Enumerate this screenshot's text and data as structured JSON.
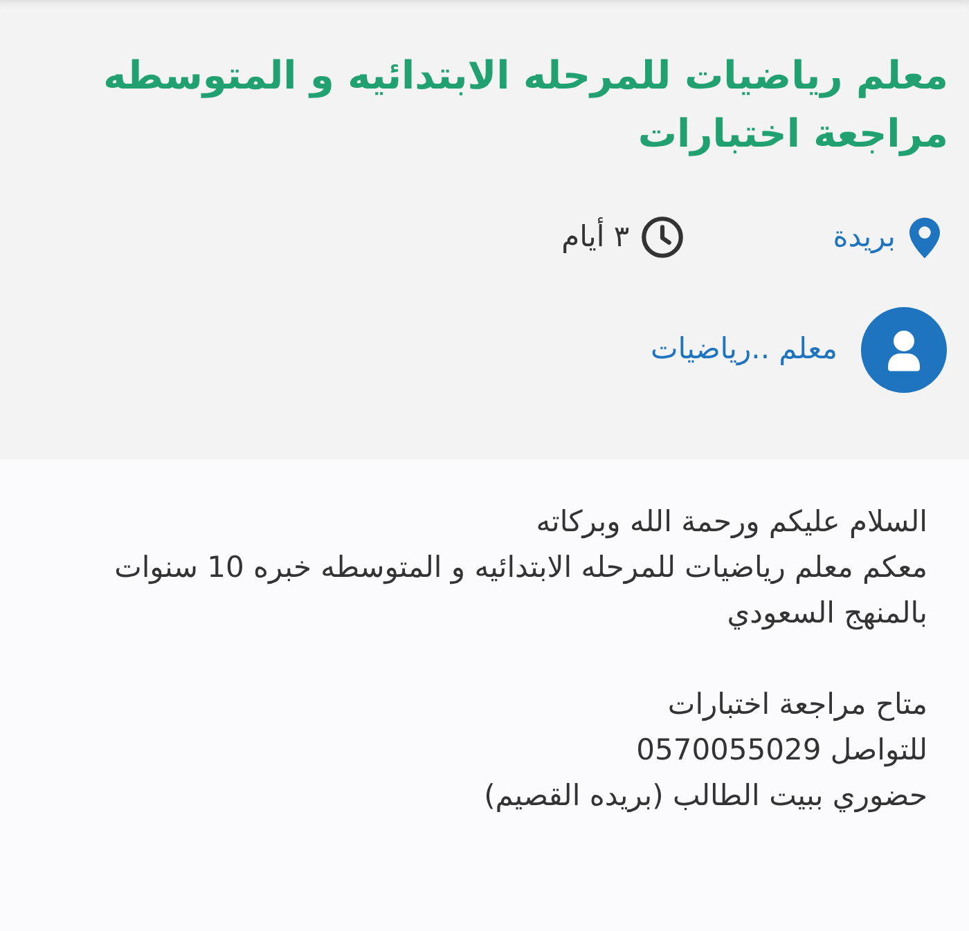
{
  "listing": {
    "title": "معلم رياضيات للمرحله الابتدائيه و المتوسطه مراجعة اختبارات",
    "location": "بريدة",
    "age": "٣ أيام",
    "author": "معلم ..رياضيات"
  },
  "description": {
    "paragraphs": [
      [
        "السلام عليكم ورحمة الله وبركاته",
        "معكم معلم رياضيات للمرحله الابتدائيه و المتوسطه خبره 10 سنوات بالمنهج السعودي"
      ],
      [
        "متاح مراجعة اختبارات",
        "للتواصل 0570055029",
        "حضوري ببيت الطالب (بريده القصيم)"
      ]
    ]
  }
}
